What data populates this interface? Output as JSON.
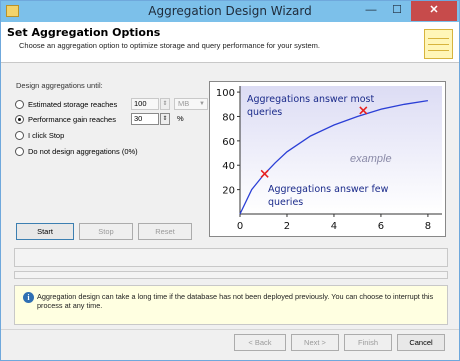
{
  "window": {
    "title": "Aggregation Design Wizard",
    "min_glyph": "—",
    "max_glyph": "☐",
    "close_glyph": "✕"
  },
  "header": {
    "title": "Set Aggregation Options",
    "subtitle": "Choose an aggregation option to optimize storage and query performance for your system."
  },
  "options": {
    "group_label": "Design aggregations until:",
    "items": [
      {
        "label": "Estimated storage reaches",
        "checked": false,
        "value": "100",
        "unit": "MB",
        "enabled": false
      },
      {
        "label": "Performance gain reaches",
        "checked": true,
        "value": "30",
        "unit": "%",
        "enabled": true
      },
      {
        "label": "I click Stop",
        "checked": false
      },
      {
        "label": "Do not design aggregations (0%)",
        "checked": false
      }
    ]
  },
  "actions": {
    "start": "Start",
    "stop": "Stop",
    "reset": "Reset"
  },
  "info": {
    "icon": "info-icon",
    "text": "Aggregation design can take a long time if the database has not been deployed previously. You can choose to interrupt this process at any time."
  },
  "footer": {
    "back": "< Back",
    "next": "Next >",
    "finish": "Finish",
    "cancel": "Cancel"
  },
  "chart_data": {
    "type": "line",
    "x_ticks": [
      0,
      2,
      4,
      6,
      8
    ],
    "y_ticks": [
      20,
      40,
      60,
      80,
      100
    ],
    "xlim": [
      0,
      8.6
    ],
    "ylim": [
      0,
      105
    ],
    "series": [
      {
        "x": [
          0,
          0.5,
          1,
          1.5,
          2,
          3,
          4,
          5,
          6,
          7,
          8
        ],
        "y": [
          0,
          20,
          32,
          42,
          51,
          64,
          73,
          80,
          86,
          90,
          93
        ]
      }
    ],
    "markers": [
      {
        "x": 1.05,
        "y": 33,
        "label": "Aggregations answer few queries"
      },
      {
        "x": 5.25,
        "y": 85,
        "label": "Aggregations answer most queries"
      }
    ],
    "watermark": "example",
    "colors": {
      "line": "#2b3fd6",
      "marker": "#e82020",
      "label": "#1a2a8a",
      "background_top": "#dcdcf4",
      "background_bottom": "#ffffff"
    }
  }
}
